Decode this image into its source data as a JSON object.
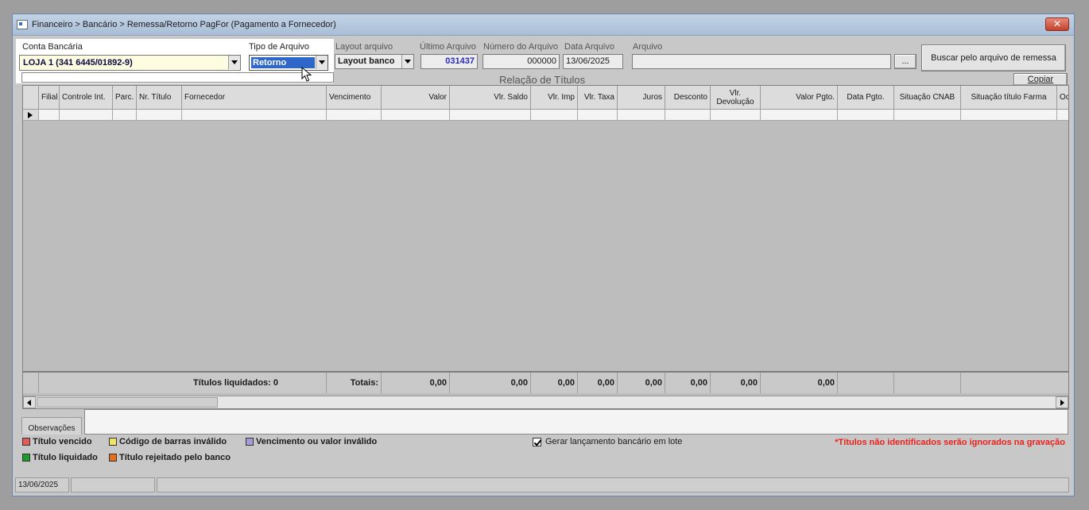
{
  "window": {
    "title": "Financeiro > Bancário > Remessa/Retorno PagFor (Pagamento  a Fornecedor)",
    "close_glyph": "✕"
  },
  "filters": {
    "conta_label": "Conta Bancária",
    "conta_value": "LOJA 1 (341 6445/01892-9)",
    "tipo_label": "Tipo de Arquivo",
    "tipo_value": "Retorno",
    "layout_label": "Layout arquivo",
    "layout_value": "Layout banco",
    "ultimo_label": "Último Arquivo",
    "ultimo_value": "031437",
    "numero_label": "Número do Arquivo",
    "numero_value": "000000",
    "data_label": "Data Arquivo",
    "data_value": "13/06/2025",
    "arquivo_label": "Arquivo",
    "arquivo_value": "",
    "browse_label": "...",
    "buscar_label": "Buscar pelo arquivo de remessa"
  },
  "grid": {
    "section_title": "Relação de Títulos",
    "copiar_label": "Copiar",
    "columns": [
      "Filial",
      "Controle Int.",
      "Parc.",
      "Nr. Título",
      "Fornecedor",
      "Vencimento",
      "Valor",
      "Vlr. Saldo",
      "Vlr. Imp",
      "Vlr. Taxa",
      "Juros",
      "Desconto",
      "Vlr. Devolução",
      "Valor Pgto.",
      "Data Pgto.",
      "Situação CNAB",
      "Situação título Farma",
      "Oc"
    ],
    "footer": {
      "liquidados": "Títulos liquidados: 0",
      "totais": "Totais:",
      "valor": "0,00",
      "saldo": "0,00",
      "imp": "0,00",
      "taxa": "0,00",
      "juros": "0,00",
      "desconto": "0,00",
      "devolucao": "0,00",
      "pgto": "0,00"
    }
  },
  "observacoes": {
    "tab_label": "Observações",
    "value": ""
  },
  "legend": {
    "vencido": "Título vencido",
    "codigo": "Código de barras inválido",
    "vencimento": "Vencimento ou valor inválido",
    "liquidado": "Título liquidado",
    "rejeitado": "Título rejeitado pelo banco",
    "colors": {
      "vencido": "#e35b5b",
      "codigo": "#f0e26a",
      "vencimento": "#a59bd6",
      "liquidado": "#1e9a2e",
      "rejeitado": "#e0701c"
    }
  },
  "options": {
    "gerar_lote_label": "Gerar lançamento bancário em lote",
    "gerar_lote_checked": true,
    "warning": "*Títulos não identificados serão ignorados na gravação"
  },
  "status": {
    "date": "13/06/2025",
    "field2": "",
    "field3": ""
  }
}
